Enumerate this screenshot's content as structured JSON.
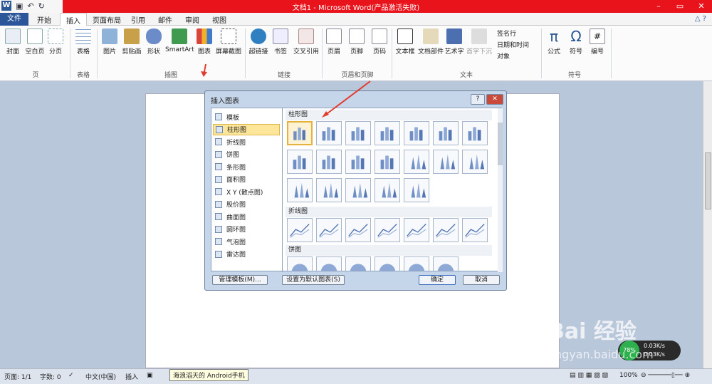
{
  "window": {
    "title": "文档1 - Microsoft Word(产品激活失败)"
  },
  "tabs": [
    "文件",
    "开始",
    "插入",
    "页面布局",
    "引用",
    "邮件",
    "审阅",
    "视图"
  ],
  "ribbon": {
    "buttons": [
      "封面",
      "空白页",
      "分页",
      "表格",
      "图片",
      "剪贴画",
      "形状",
      "SmartArt",
      "图表",
      "屏幕截图",
      "超链接",
      "书签",
      "交叉引用",
      "页眉",
      "页脚",
      "页码",
      "文本框",
      "文档部件",
      "艺术字",
      "首字下沉",
      "公式",
      "符号",
      "编号"
    ],
    "small_items": [
      "签名行",
      "日期和时间",
      "对象"
    ],
    "groups": [
      "页",
      "表格",
      "插图",
      "链接",
      "页眉和页脚",
      "文本",
      "符号"
    ]
  },
  "dialog": {
    "title": "插入图表",
    "categories": [
      "模板",
      "柱形图",
      "折线图",
      "饼图",
      "条形图",
      "面积图",
      "X Y (散点图)",
      "股价图",
      "曲面图",
      "圆环图",
      "气泡图",
      "雷达图"
    ],
    "selected_category": "柱形图",
    "sections": [
      "柱形图",
      "折线图",
      "饼图"
    ],
    "buttons": {
      "manage": "管理模板(M)...",
      "set_default": "设置为默认图表(S)",
      "ok": "确定",
      "cancel": "取消"
    },
    "help": "?"
  },
  "statusbar": {
    "page": "页面: 1/1",
    "words": "字数: 0",
    "lang": "中文(中国)",
    "mode": "插入",
    "zoom": "100%",
    "tooltip": "海浪滔天的 Android手机"
  },
  "watermark": {
    "brand": "Bai 经验",
    "url": "jingyan.baidu.com"
  },
  "net": {
    "percent": "78%",
    "speed_up": "0.03K/s",
    "speed_down": "0.03K/s"
  }
}
